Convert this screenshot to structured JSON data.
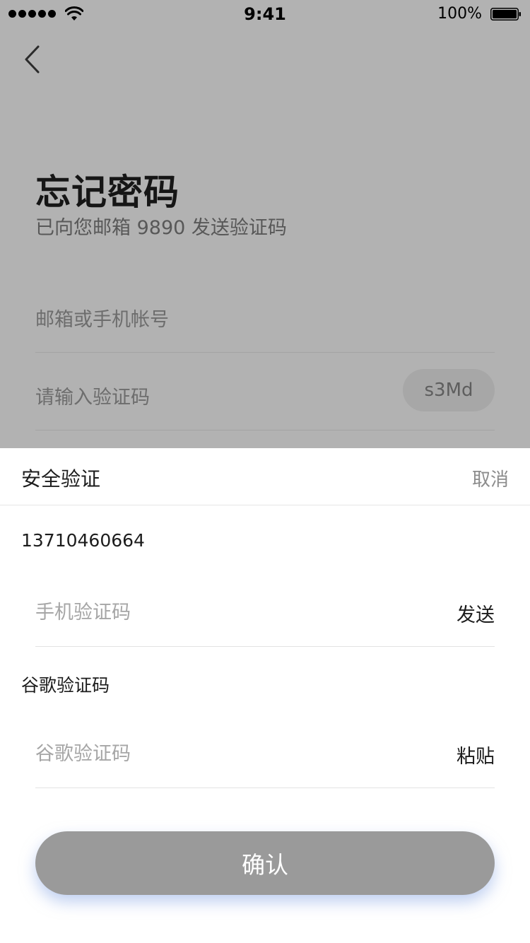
{
  "status_bar": {
    "time": "9:41",
    "battery": "100%",
    "signal_icon": "signal-dots-icon",
    "wifi_icon": "wifi-icon",
    "battery_icon": "battery-icon"
  },
  "page": {
    "back_icon": "chevron-left-icon",
    "title": "忘记密码",
    "subtitle": "已向您邮箱 9890 发送验证码",
    "account_placeholder": "邮箱或手机帐号",
    "code_placeholder": "请输入验证码",
    "captcha": "s3Md"
  },
  "sheet": {
    "title": "安全验证",
    "cancel": "取消",
    "phone": "13710460664",
    "phone_code_placeholder": "手机验证码",
    "send": "发送",
    "google_section": "谷歌验证码",
    "google_code_placeholder": "谷歌验证码",
    "paste": "粘贴",
    "confirm": "确认"
  },
  "colors": {
    "overlay_bg": "#b2b2b2",
    "sheet_bg": "#ffffff",
    "button_bg": "#9a9a9a",
    "button_glow": "#8caae6"
  }
}
